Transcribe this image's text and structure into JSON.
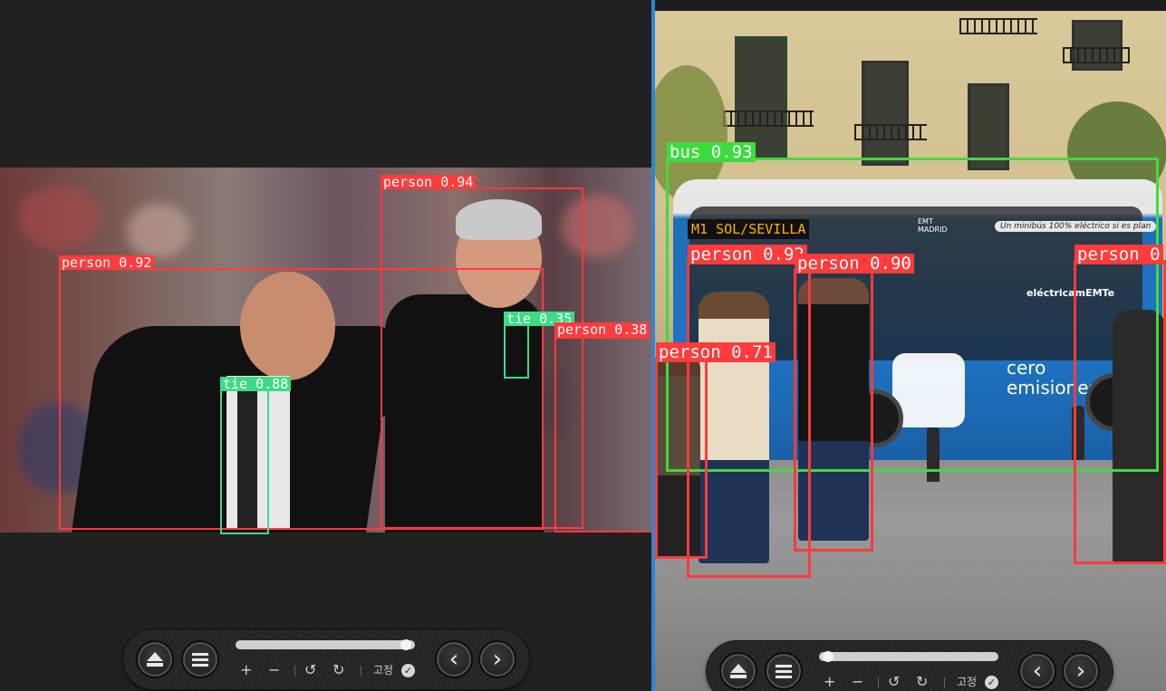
{
  "left_viewer": {
    "detections": [
      {
        "label": "person 0.94",
        "color": "#ff3b3b"
      },
      {
        "label": "person 0.92",
        "color": "#ff3b3b"
      },
      {
        "label": "tie 0.35",
        "color": "#3ddc84"
      },
      {
        "label": "person 0.38",
        "color": "#ff3b3b"
      },
      {
        "label": "tie 0.88",
        "color": "#3ddc84"
      }
    ],
    "toolbar": {
      "eject_icon": "eject-icon",
      "menu_icon": "menu-icon",
      "slider_progress": 0.98,
      "zoom_in": "+",
      "zoom_out": "−",
      "rotate_left": "↺",
      "rotate_right": "↻",
      "fix_label": "고정",
      "fix_check": "✓",
      "prev": "‹",
      "next": "›"
    }
  },
  "right_viewer": {
    "detections": [
      {
        "label": "bus 0.93",
        "color": "#3ddc3d"
      },
      {
        "label": "person 0.92",
        "color": "#ff3b3b"
      },
      {
        "label": "person 0.90",
        "color": "#ff3b3b"
      },
      {
        "label": "person 0",
        "color": "#ff3b3b"
      },
      {
        "label": "person 0.71",
        "color": "#ff3b3b"
      }
    ],
    "scene_text": {
      "route_sign": "M1 SOL/SEVILLA",
      "bus_logo": "EMT MADRID",
      "slogan": "Un minibús 100% eléctrico si es plan",
      "bus_side_1": "cero",
      "bus_side_2": "emisiones",
      "brand": "eléctricamEMTe"
    },
    "toolbar": {
      "eject_icon": "eject-icon",
      "menu_icon": "menu-icon",
      "slider_progress": 0.02,
      "zoom_in": "+",
      "zoom_out": "−",
      "rotate_left": "↺",
      "rotate_right": "↻",
      "fix_label": "고정",
      "fix_check": "✓",
      "prev": "‹",
      "next": "›"
    }
  }
}
